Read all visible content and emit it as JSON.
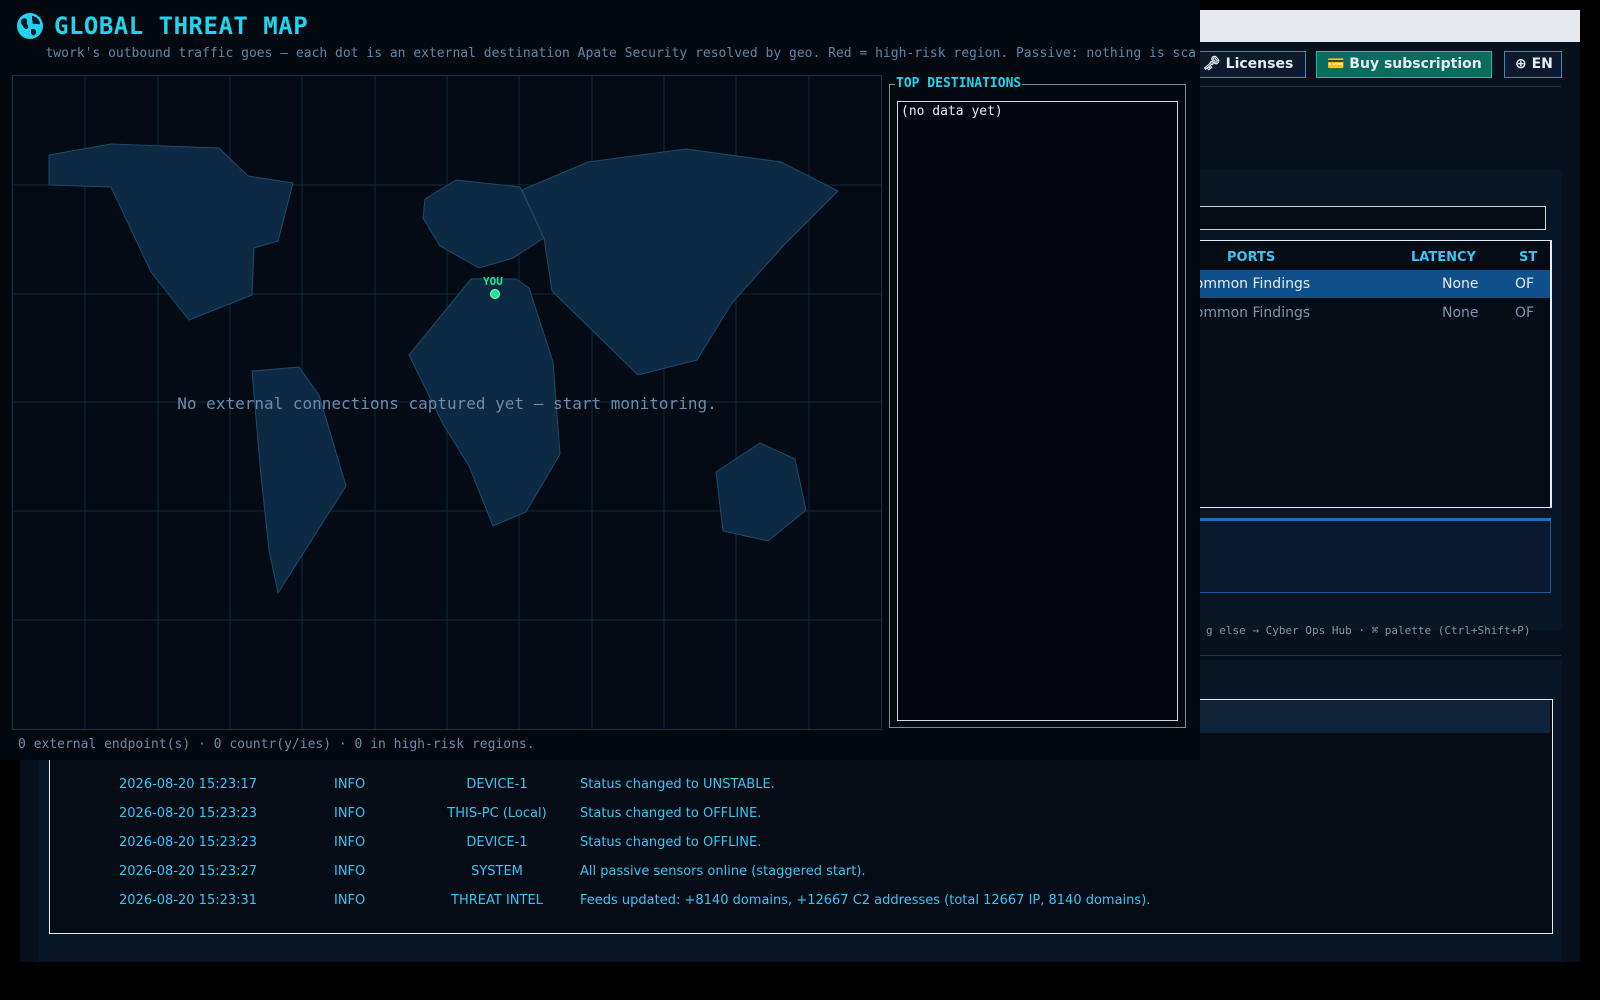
{
  "background_app": {
    "header": {
      "licenses_label": "🗝 Licenses",
      "buy_label": "💳 Buy subscription",
      "language_label": "⊕ EN"
    },
    "table": {
      "columns": [
        "PORTS",
        "LATENCY",
        "ST"
      ],
      "rows": [
        {
          "ports": "Common Findings",
          "latency": "None",
          "status": "OF",
          "selected": true
        },
        {
          "ports": "Common Findings",
          "latency": "None",
          "status": "OF",
          "selected": false
        }
      ]
    },
    "hint": "g else → Cyber Ops Hub  ·  ⌘ palette (Ctrl+Shift+P)",
    "log": [
      {
        "time": "2026-08-20 15:23:17",
        "level": "INFO",
        "source": "DEVICE-1",
        "message": "Status changed to UNSTABLE."
      },
      {
        "time": "2026-08-20 15:23:23",
        "level": "INFO",
        "source": "THIS-PC (Local)",
        "message": "Status changed to OFFLINE."
      },
      {
        "time": "2026-08-20 15:23:23",
        "level": "INFO",
        "source": "DEVICE-1",
        "message": "Status changed to OFFLINE."
      },
      {
        "time": "2026-08-20 15:23:27",
        "level": "INFO",
        "source": "SYSTEM",
        "message": "All passive sensors online (staggered start)."
      },
      {
        "time": "2026-08-20 15:23:31",
        "level": "INFO",
        "source": "THREAT INTEL",
        "message": "Feeds updated: +8140 domains, +12667 C2 addresses (total 12667 IP, 8140 domains)."
      }
    ]
  },
  "threat_map": {
    "title": "GLOBAL THREAT MAP",
    "subtitle": "twork's outbound traffic goes — each dot is an external destination Apate Security resolved by geo. Red = high-risk region. Passive: nothing is sca",
    "icon": "globe-icon",
    "you_label": "YOU",
    "empty_message": "No external connections captured yet — start monitoring.",
    "status": "0 external endpoint(s) · 0 countr(y/ies) · 0 in high-risk regions.",
    "top_destinations": {
      "legend": "TOP DESTINATIONS",
      "empty": "(no data yet)"
    },
    "colors": {
      "accent": "#22d3ee",
      "land": "#0c2a44",
      "you_marker": "#22e38a"
    }
  }
}
